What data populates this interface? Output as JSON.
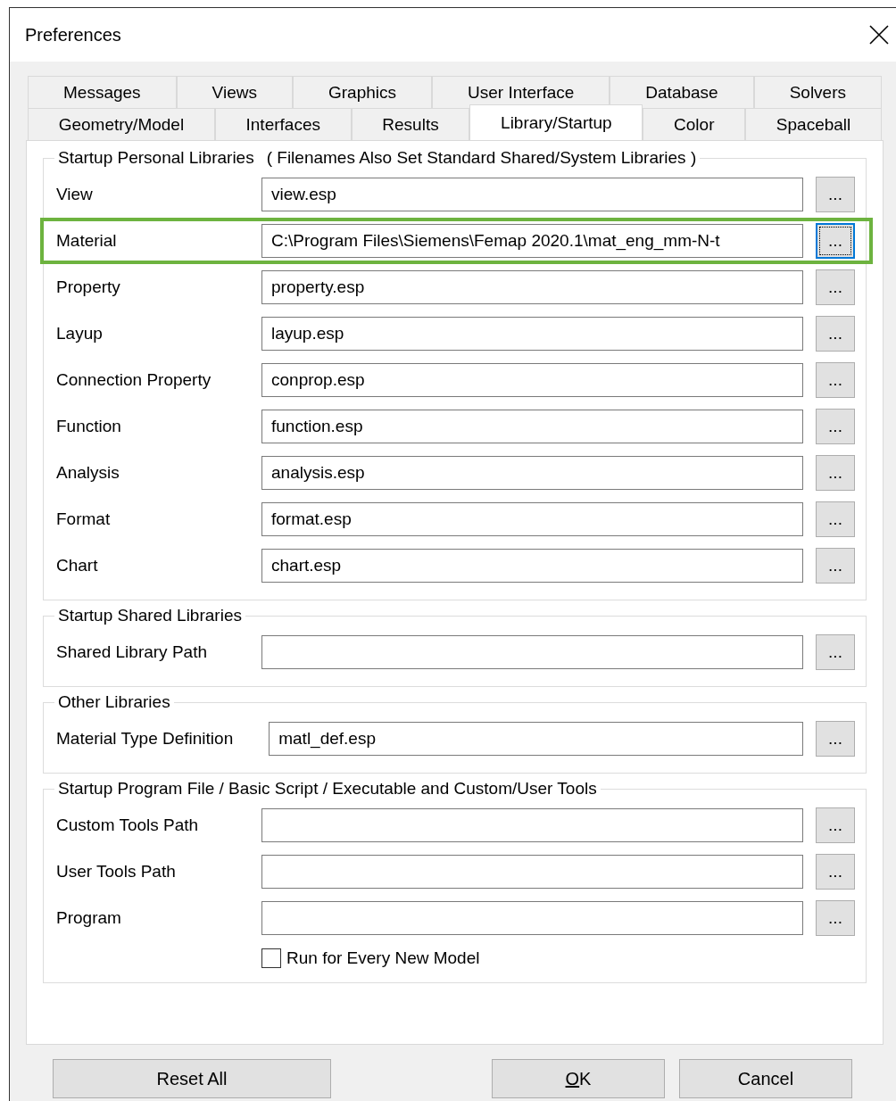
{
  "window": {
    "title": "Preferences"
  },
  "tab_rows": [
    {
      "tabs": [
        {
          "label": "Messages",
          "selected": false
        },
        {
          "label": "Views",
          "selected": false
        },
        {
          "label": "Graphics",
          "selected": false
        },
        {
          "label": "User Interface",
          "selected": false
        },
        {
          "label": "Database",
          "selected": false
        },
        {
          "label": "Solvers",
          "selected": false
        }
      ]
    },
    {
      "tabs": [
        {
          "label": "Geometry/Model",
          "selected": false
        },
        {
          "label": "Interfaces",
          "selected": false
        },
        {
          "label": "Results",
          "selected": false
        },
        {
          "label": "Library/Startup",
          "selected": true
        },
        {
          "label": "Color",
          "selected": false
        },
        {
          "label": "Spaceball",
          "selected": false
        }
      ]
    }
  ],
  "sections": [
    {
      "title": "Startup Personal Libraries",
      "note": "( Filenames Also Set Standard Shared/System Libraries )",
      "rows": [
        {
          "label": "View",
          "value": "view.esp",
          "browse": "...",
          "highlighted": false,
          "focused": false
        },
        {
          "label": "Material",
          "value": "C:\\Program Files\\Siemens\\Femap 2020.1\\mat_eng_mm-N-t",
          "browse": "...",
          "highlighted": true,
          "focused": true
        },
        {
          "label": "Property",
          "value": "property.esp",
          "browse": "...",
          "highlighted": false,
          "focused": false
        },
        {
          "label": "Layup",
          "value": "layup.esp",
          "browse": "...",
          "highlighted": false,
          "focused": false
        },
        {
          "label": "Connection Property",
          "value": "conprop.esp",
          "browse": "...",
          "highlighted": false,
          "focused": false
        },
        {
          "label": "Function",
          "value": "function.esp",
          "browse": "...",
          "highlighted": false,
          "focused": false
        },
        {
          "label": "Analysis",
          "value": "analysis.esp",
          "browse": "...",
          "highlighted": false,
          "focused": false
        },
        {
          "label": "Format",
          "value": "format.esp",
          "browse": "...",
          "highlighted": false,
          "focused": false
        },
        {
          "label": "Chart",
          "value": "chart.esp",
          "browse": "...",
          "highlighted": false,
          "focused": false
        }
      ]
    },
    {
      "title": "Startup Shared Libraries",
      "rows": [
        {
          "label": "Shared Library Path",
          "value": "",
          "browse": "...",
          "highlighted": false,
          "focused": false
        }
      ]
    },
    {
      "title": "Other Libraries",
      "rows": [
        {
          "label": "Material Type Definition",
          "value": "matl_def.esp",
          "browse": "...",
          "highlighted": false,
          "focused": false
        }
      ]
    },
    {
      "title": "Startup Program File / Basic Script / Executable and Custom/User Tools",
      "rows": [
        {
          "label": "Custom Tools Path",
          "value": "",
          "browse": "...",
          "highlighted": false,
          "focused": false
        },
        {
          "label": "User Tools Path",
          "value": "",
          "browse": "...",
          "highlighted": false,
          "focused": false
        },
        {
          "label": "Program",
          "value": "",
          "browse": "...",
          "highlighted": false,
          "focused": false
        }
      ],
      "checkbox": {
        "label": "Run for Every New Model",
        "checked": false
      }
    }
  ],
  "left_buttons": [
    {
      "label": "Reset All",
      "underline_first": false
    }
  ],
  "right_buttons": [
    {
      "label": "OK",
      "underline_first": true
    },
    {
      "label": "Cancel",
      "underline_first": false
    }
  ]
}
